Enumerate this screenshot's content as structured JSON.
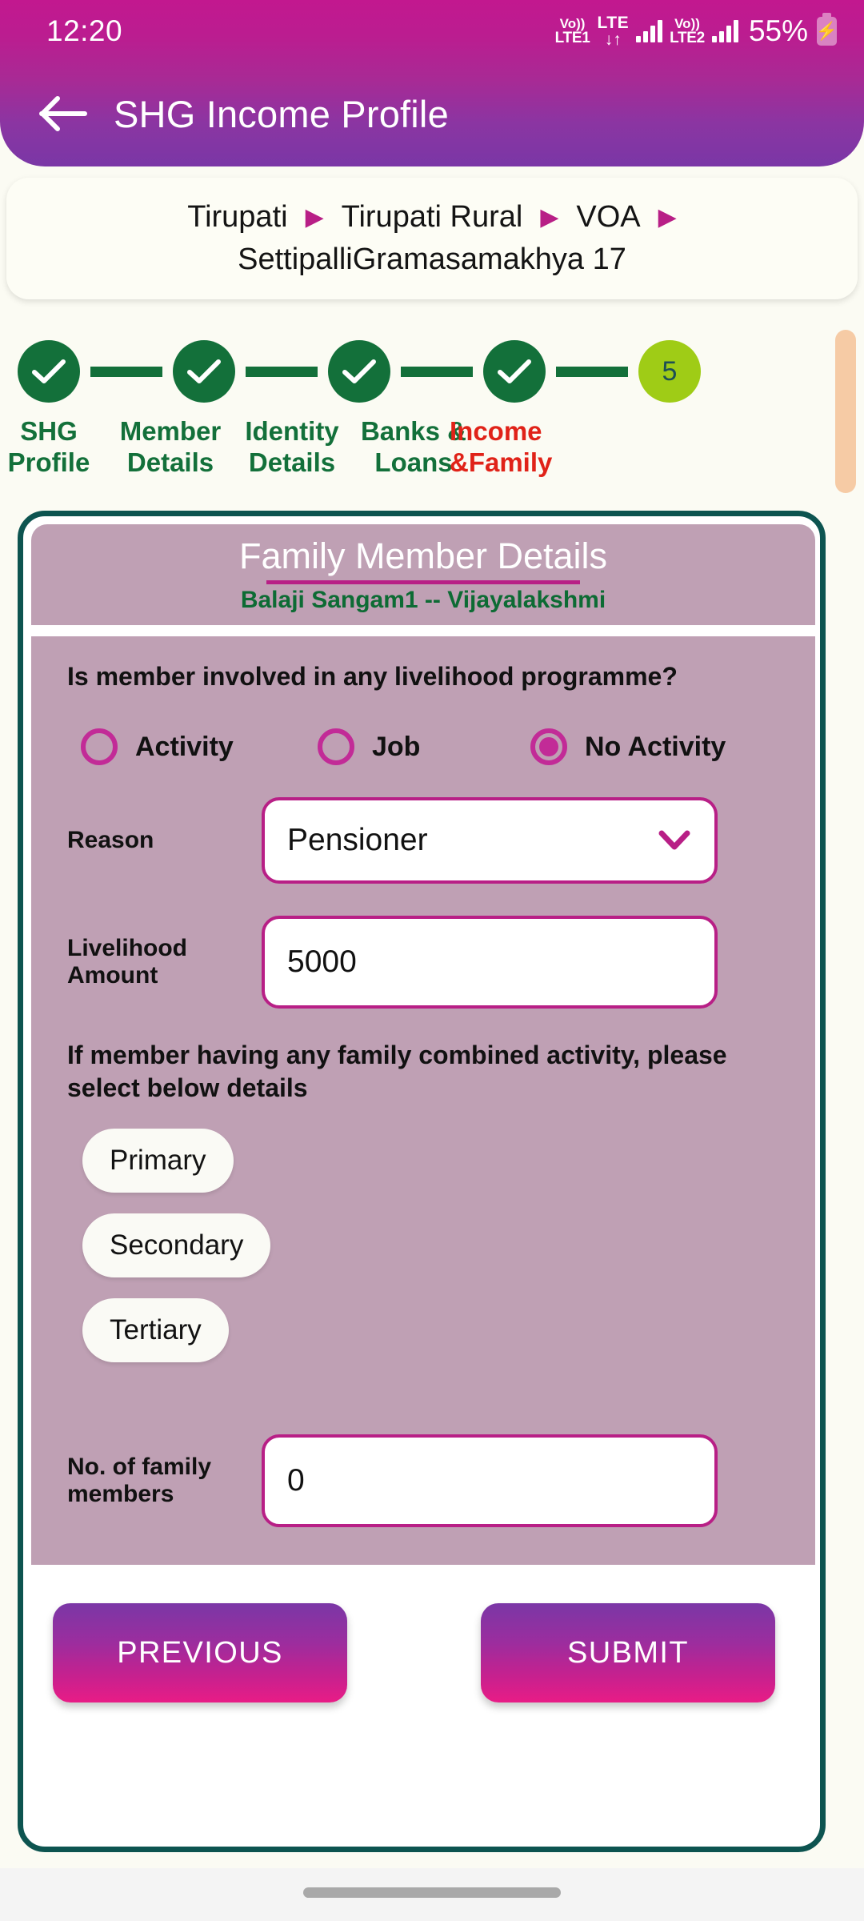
{
  "status_bar": {
    "time": "12:20",
    "sim1_top": "Vo))",
    "sim1_bottom": "LTE1",
    "lte_top": "LTE",
    "lte_bottom": "↓↑",
    "sim2_top": "Vo))",
    "sim2_bottom": "LTE2",
    "battery": "55%"
  },
  "app_bar": {
    "title": "SHG Income Profile",
    "back_icon": "back-arrow-icon"
  },
  "breadcrumb": {
    "items": [
      "Tirupati",
      "Tirupati Rural",
      "VOA"
    ],
    "separator": "▶",
    "trailing_separator": "▶",
    "second_line": "SettipalliGramasamakhya 17"
  },
  "stepper": {
    "steps": [
      {
        "label_line1": "SHG",
        "label_line2": "Profile",
        "state": "done",
        "marker": "check"
      },
      {
        "label_line1": "Member",
        "label_line2": "Details",
        "state": "done",
        "marker": "check"
      },
      {
        "label_line1": "Identity",
        "label_line2": "Details",
        "state": "done",
        "marker": "check"
      },
      {
        "label_line1": "Banks &",
        "label_line2": "Loans",
        "state": "done",
        "marker": "check"
      },
      {
        "label_line1": "Income",
        "label_line2": "&Family",
        "state": "current",
        "marker": "5"
      }
    ],
    "colors": {
      "done": "#13703a",
      "current": "#9fcc16",
      "active_label": "#e02218",
      "done_label": "#13703a"
    }
  },
  "card": {
    "title": "Family Member Details",
    "subtitle": "Balaji Sangam1 -- Vijayalakshmi",
    "question": "Is member involved in any livelihood programme?",
    "radio_options": [
      {
        "label": "Activity",
        "selected": false
      },
      {
        "label": "Job",
        "selected": false
      },
      {
        "label": "No Activity",
        "selected": true
      }
    ],
    "reason": {
      "label": "Reason",
      "value": "Pensioner",
      "dropdown_icon": "chevron-down-icon"
    },
    "livelihood_amount": {
      "label": "Livelihood Amount",
      "value": "5000"
    },
    "combined_note": "If member having any family combined activity, please select below details",
    "chips": [
      "Primary",
      "Secondary",
      "Tertiary"
    ],
    "family_members": {
      "label": "No. of family members",
      "value": "0"
    }
  },
  "actions": {
    "previous": "PREVIOUS",
    "submit": "SUBMIT"
  },
  "colors": {
    "accent_magenta": "#b81f86",
    "card_bg": "#bfa0b4",
    "card_border": "#0d5450",
    "scrollbar": "#f6cba5",
    "page_bg": "#fbfbf3"
  }
}
